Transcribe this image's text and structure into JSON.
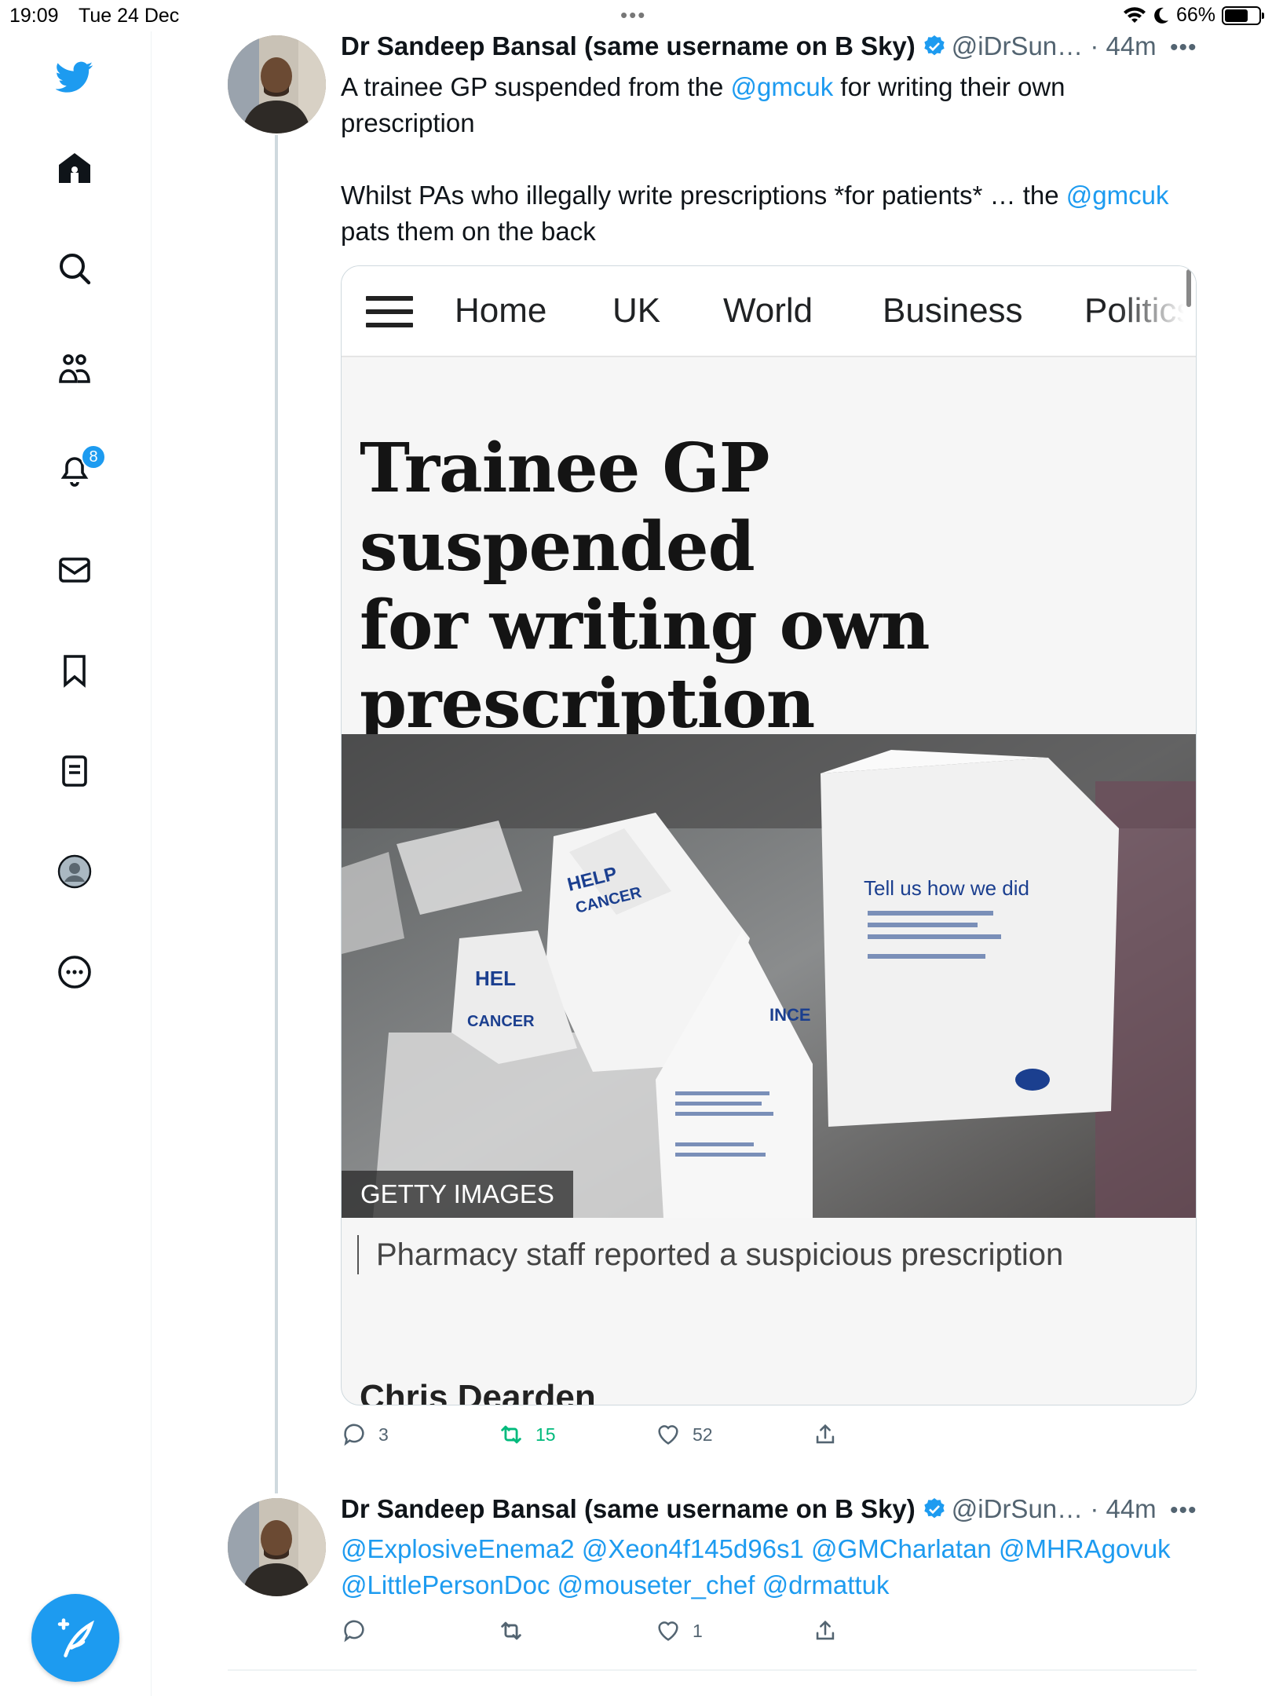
{
  "status_bar": {
    "time": "19:09",
    "date": "Tue 24 Dec",
    "battery": "66%",
    "battery_level": 0.66
  },
  "sidebar": {
    "items": [
      {
        "icon": "home-icon",
        "label": "Home"
      },
      {
        "icon": "search-icon",
        "label": "Explore"
      },
      {
        "icon": "communities-icon",
        "label": "Communities"
      },
      {
        "icon": "bell-icon",
        "label": "Notifications",
        "badge": "8"
      },
      {
        "icon": "mail-icon",
        "label": "Messages"
      },
      {
        "icon": "bookmark-icon",
        "label": "Bookmarks"
      },
      {
        "icon": "lists-icon",
        "label": "Lists"
      },
      {
        "icon": "profile-icon",
        "label": "Profile"
      },
      {
        "icon": "more-icon",
        "label": "More"
      }
    ],
    "compose_label": "+"
  },
  "tweets": [
    {
      "author_name": "Dr Sandeep Bansal (same username on B Sky)",
      "handle_time": "@iDrSun… · 44m",
      "text_line1_a": "A trainee GP suspended from the ",
      "text_line1_link": "@gmcuk",
      "text_line1_b": " for writing their own",
      "text_line2": "prescription",
      "text_line3_a": "Whilst PAs who illegally write prescriptions *for patients* … the ",
      "text_line3_link": "@gmcuk",
      "text_line4": "pats them on the back",
      "card": {
        "nav": [
          "Home",
          "UK",
          "World",
          "Business",
          "Politics"
        ],
        "headline_lines": [
          "Trainee GP suspended",
          "for writing own",
          "prescription"
        ],
        "photo_credit": "GETTY IMAGES",
        "caption": "Pharmacy staff reported a suspicious prescription",
        "author": "Chris Dearden",
        "photo_texts": {
          "bag_main": "Tell us how we did",
          "bag_small": "HERE TO HELP YOU WITH CANCER"
        }
      },
      "stats": {
        "replies": "3",
        "retweets": "15",
        "likes": "52"
      }
    },
    {
      "author_name": "Dr Sandeep Bansal (same username on B Sky)",
      "handle_time": "@iDrSun… · 44m",
      "mentions_line1": "@ExplosiveEnema2 @Xeon4f145d96s1 @GMCharlatan @MHRAgovuk",
      "mentions_line2": "@LittlePersonDoc @mouseter_chef @drmattuk",
      "stats": {
        "replies": "",
        "retweets": "",
        "likes": "1"
      }
    }
  ],
  "colors": {
    "accent": "#1d9bf0",
    "retweet_active": "#00ba7c",
    "secondary_text": "#536471",
    "border": "#cfd9de"
  }
}
